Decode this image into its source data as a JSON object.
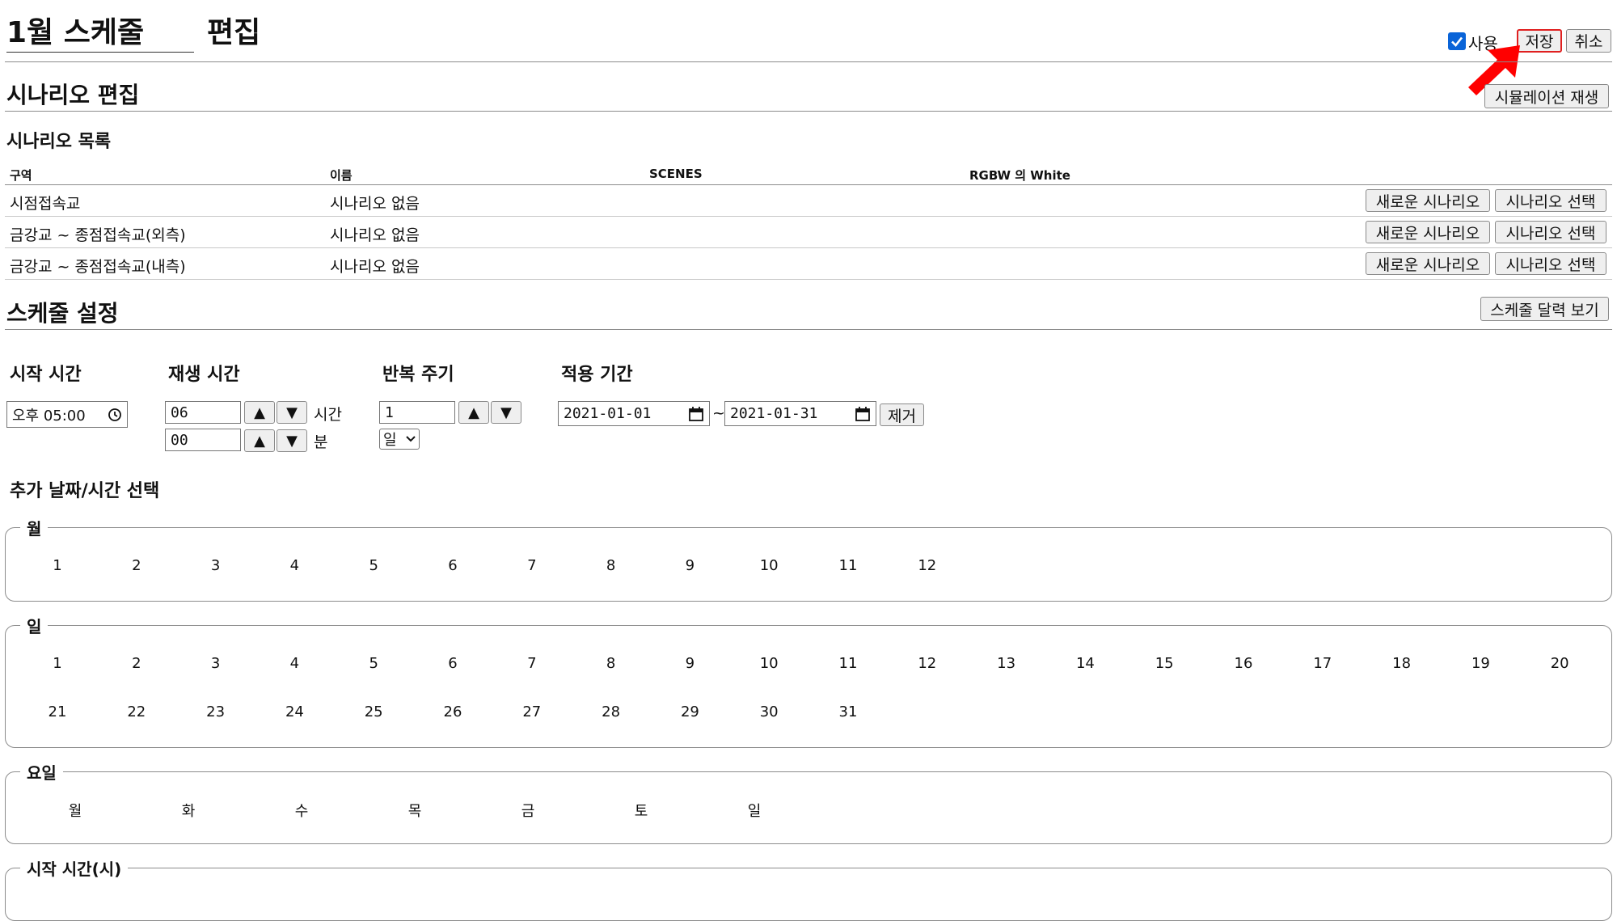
{
  "header": {
    "title_input": "1월 스케줄",
    "title_suffix": "편집",
    "use_label": "사용",
    "use_checked": true,
    "save_label": "저장",
    "cancel_label": "취소"
  },
  "scenario_edit": {
    "heading": "시나리오 편집",
    "simulation_button": "시뮬레이션 재생"
  },
  "scenario_list": {
    "heading": "시나리오 목록",
    "columns": [
      "구역",
      "이름",
      "SCENES",
      "RGBW 의 White"
    ],
    "rows": [
      {
        "zone": "시점접속교",
        "name": "시나리오 없음",
        "new_btn": "새로운 시나리오",
        "select_btn": "시나리오 선택"
      },
      {
        "zone": "금강교 ~ 종점접속교(외측)",
        "name": "시나리오 없음",
        "new_btn": "새로운 시나리오",
        "select_btn": "시나리오 선택"
      },
      {
        "zone": "금강교 ~ 종점접속교(내측)",
        "name": "시나리오 없음",
        "new_btn": "새로운 시나리오",
        "select_btn": "시나리오 선택"
      }
    ]
  },
  "schedule": {
    "heading": "스케줄 설정",
    "calendar_button": "스케줄 달력 보기",
    "start_time": {
      "label": "시작 시간",
      "value": "오후 05:00"
    },
    "play_time": {
      "label": "재생 시간",
      "hours": "06",
      "hours_unit": "시간",
      "minutes": "00",
      "minutes_unit": "분"
    },
    "repeat": {
      "label": "반복 주기",
      "value": "1",
      "unit_selected": "일"
    },
    "period": {
      "label": "적용 기간",
      "from": "2021-01-01",
      "separator": "~",
      "to": "2021-01-31",
      "remove_button": "제거"
    }
  },
  "extra": {
    "heading": "추가 날짜/시간 선택",
    "months_legend": "월",
    "months": [
      "1",
      "2",
      "3",
      "4",
      "5",
      "6",
      "7",
      "8",
      "9",
      "10",
      "11",
      "12"
    ],
    "days_legend": "일",
    "days": [
      "1",
      "2",
      "3",
      "4",
      "5",
      "6",
      "7",
      "8",
      "9",
      "10",
      "11",
      "12",
      "13",
      "14",
      "15",
      "16",
      "17",
      "18",
      "19",
      "20",
      "21",
      "22",
      "23",
      "24",
      "25",
      "26",
      "27",
      "28",
      "29",
      "30",
      "31"
    ],
    "weekdays_legend": "요일",
    "weekdays": [
      "월",
      "화",
      "수",
      "목",
      "금",
      "토",
      "일"
    ],
    "start_hour_legend": "시작 시간(시)"
  },
  "colors": {
    "annotation_arrow": "#ff0000",
    "button_bg": "#efefef",
    "divider": "#8c8c8c",
    "checkbox": "#0a64d8"
  }
}
